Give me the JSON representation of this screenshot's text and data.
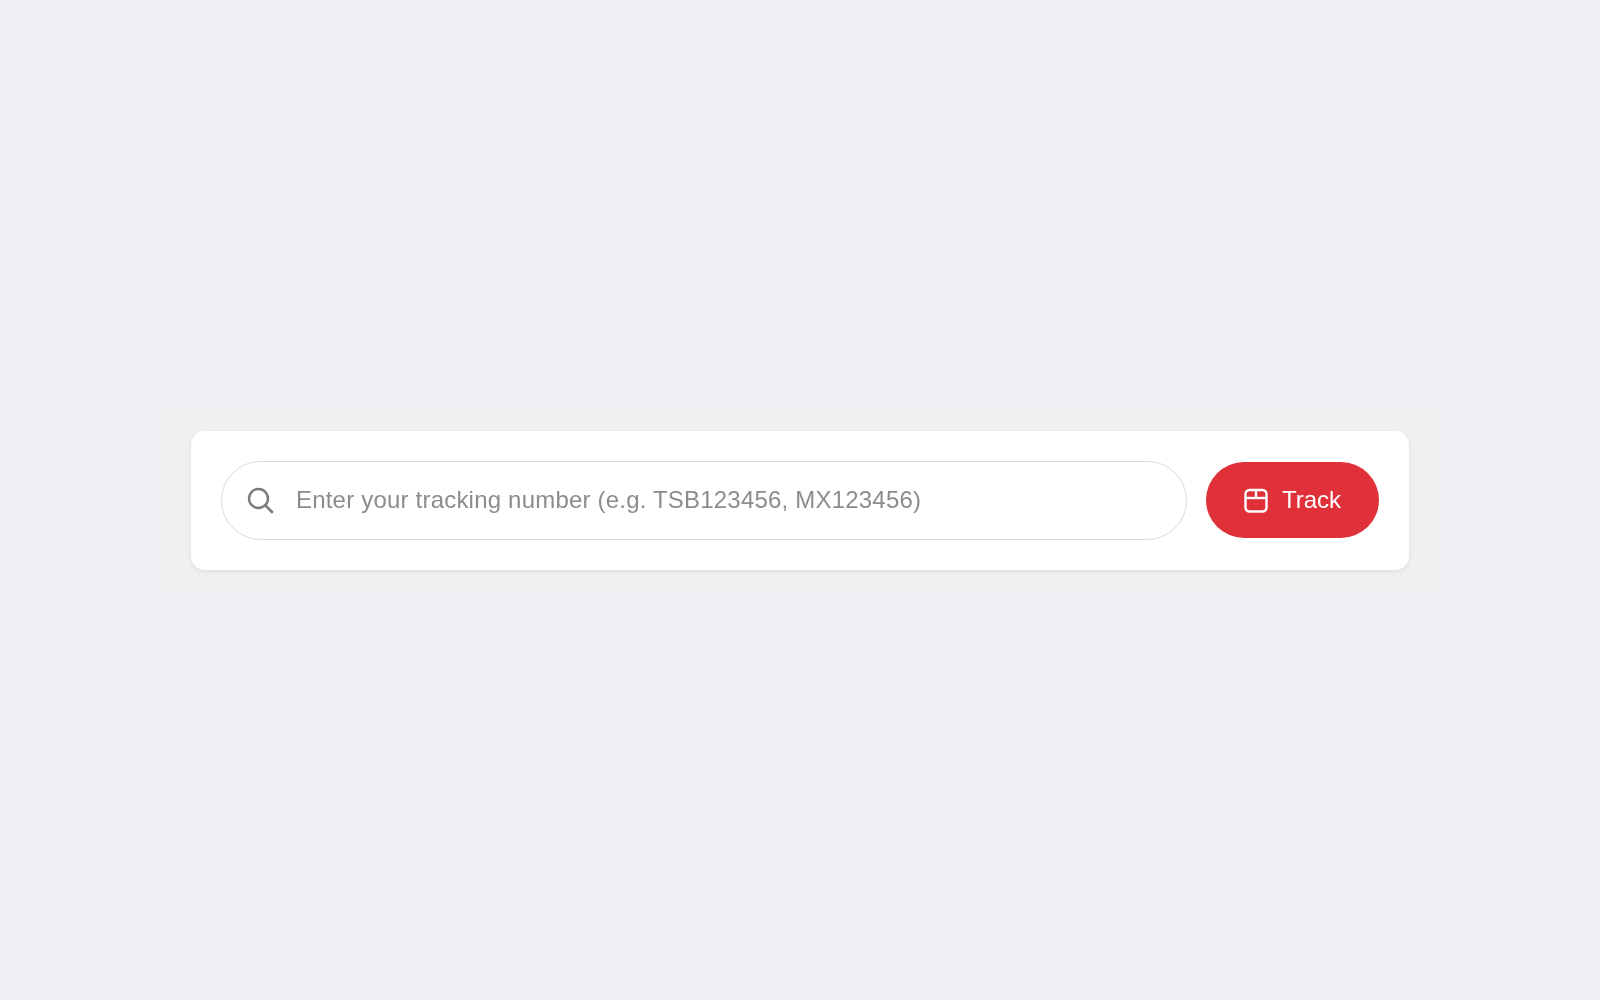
{
  "tracking_form": {
    "search": {
      "placeholder": "Enter your tracking number (e.g. TSB123456, MX123456)"
    },
    "track_button": {
      "label": "Track"
    }
  }
}
